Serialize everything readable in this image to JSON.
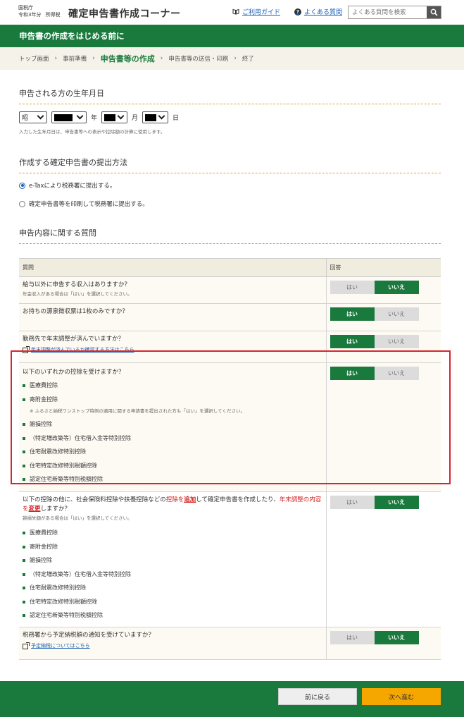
{
  "header": {
    "agency": "国税庁",
    "year": "令和3年分",
    "tax_type": "所得税",
    "title": "確定申告書作成コーナー",
    "guide_link": "ご利用ガイド",
    "faq_link": "よくある質問",
    "search_placeholder": "よくある質問を検索"
  },
  "page_banner": "申告書の作成をはじめる前に",
  "breadcrumb": [
    "トップ画面",
    "事前準備",
    "申告書等の作成",
    "申告書等の送信・印刷",
    "終了"
  ],
  "birth": {
    "title": "申告される方の生年月日",
    "era": "昭",
    "year_unit": "年",
    "month_unit": "月",
    "day_unit": "日",
    "note": "入力した生年月日は、申告書等への表示や控除額の計算に使用します。"
  },
  "submission": {
    "title": "作成する確定申告書の提出方法",
    "options": [
      "e-Taxにより税務署に提出する。",
      "確定申告書等を印刷して税務署に提出する。"
    ],
    "selected": 0
  },
  "questions": {
    "title": "申告内容に関する質問",
    "col_question": "質問",
    "col_answer": "回答",
    "yes": "はい",
    "no": "いいえ",
    "q1": {
      "text": "給与以外に申告する収入はありますか？",
      "sub": "年金収入がある場合は「はい」を選択してください。",
      "answer": "no"
    },
    "q2": {
      "text": "お持ちの源泉徴収票は1枚のみですか？",
      "answer": "yes"
    },
    "q3": {
      "text": "勤務先で年末調整が済んでいますか？",
      "link": "年末調整が済んでいるか確認する方法はこちら",
      "answer": "yes"
    },
    "q4": {
      "text": "以下のいずれかの控除を受けますか？",
      "items_a": [
        "医療費控除",
        "寄附金控除"
      ],
      "note": "※ ふるさと納税ワンストップ特例の適用に関する申請書を提出された方も「はい」を選択してください。",
      "items_b": [
        "雑損控除",
        "（特定増改築等）住宅借入金等特別控除",
        "住宅耐震改修特別控除",
        "住宅特定改修特別税額控除",
        "認定住宅新築等特別税額控除"
      ],
      "answer": "yes"
    },
    "q5": {
      "t1": "以下の控除の他に、社会保険料控除や扶養控除などの",
      "t2": "控除を",
      "t3": "追加",
      "t4": "して確定申告書を作成したり、",
      "t5": "年末調整の内容を",
      "t6": "変更",
      "t7": "しますか？",
      "sub": "雑損失額がある場合は「はい」を選択してください。",
      "items": [
        "医療費控除",
        "寄附金控除",
        "雑損控除",
        "（特定増改築等）住宅借入金等特別控除",
        "住宅耐震改修特別控除",
        "住宅特定改修特別税額控除",
        "認定住宅新築等特別税額控除"
      ],
      "answer": "no"
    },
    "q6": {
      "text": "税務署から予定納税額の通知を受けていますか？",
      "link": "予定納税についてはこちら",
      "answer": "no"
    }
  },
  "footer": {
    "back": "前に戻る",
    "next": "次へ進む"
  },
  "colors": {
    "brand_green": "#1a7a3e",
    "accent_orange": "#f5a700",
    "highlight_red": "#d9232d"
  }
}
